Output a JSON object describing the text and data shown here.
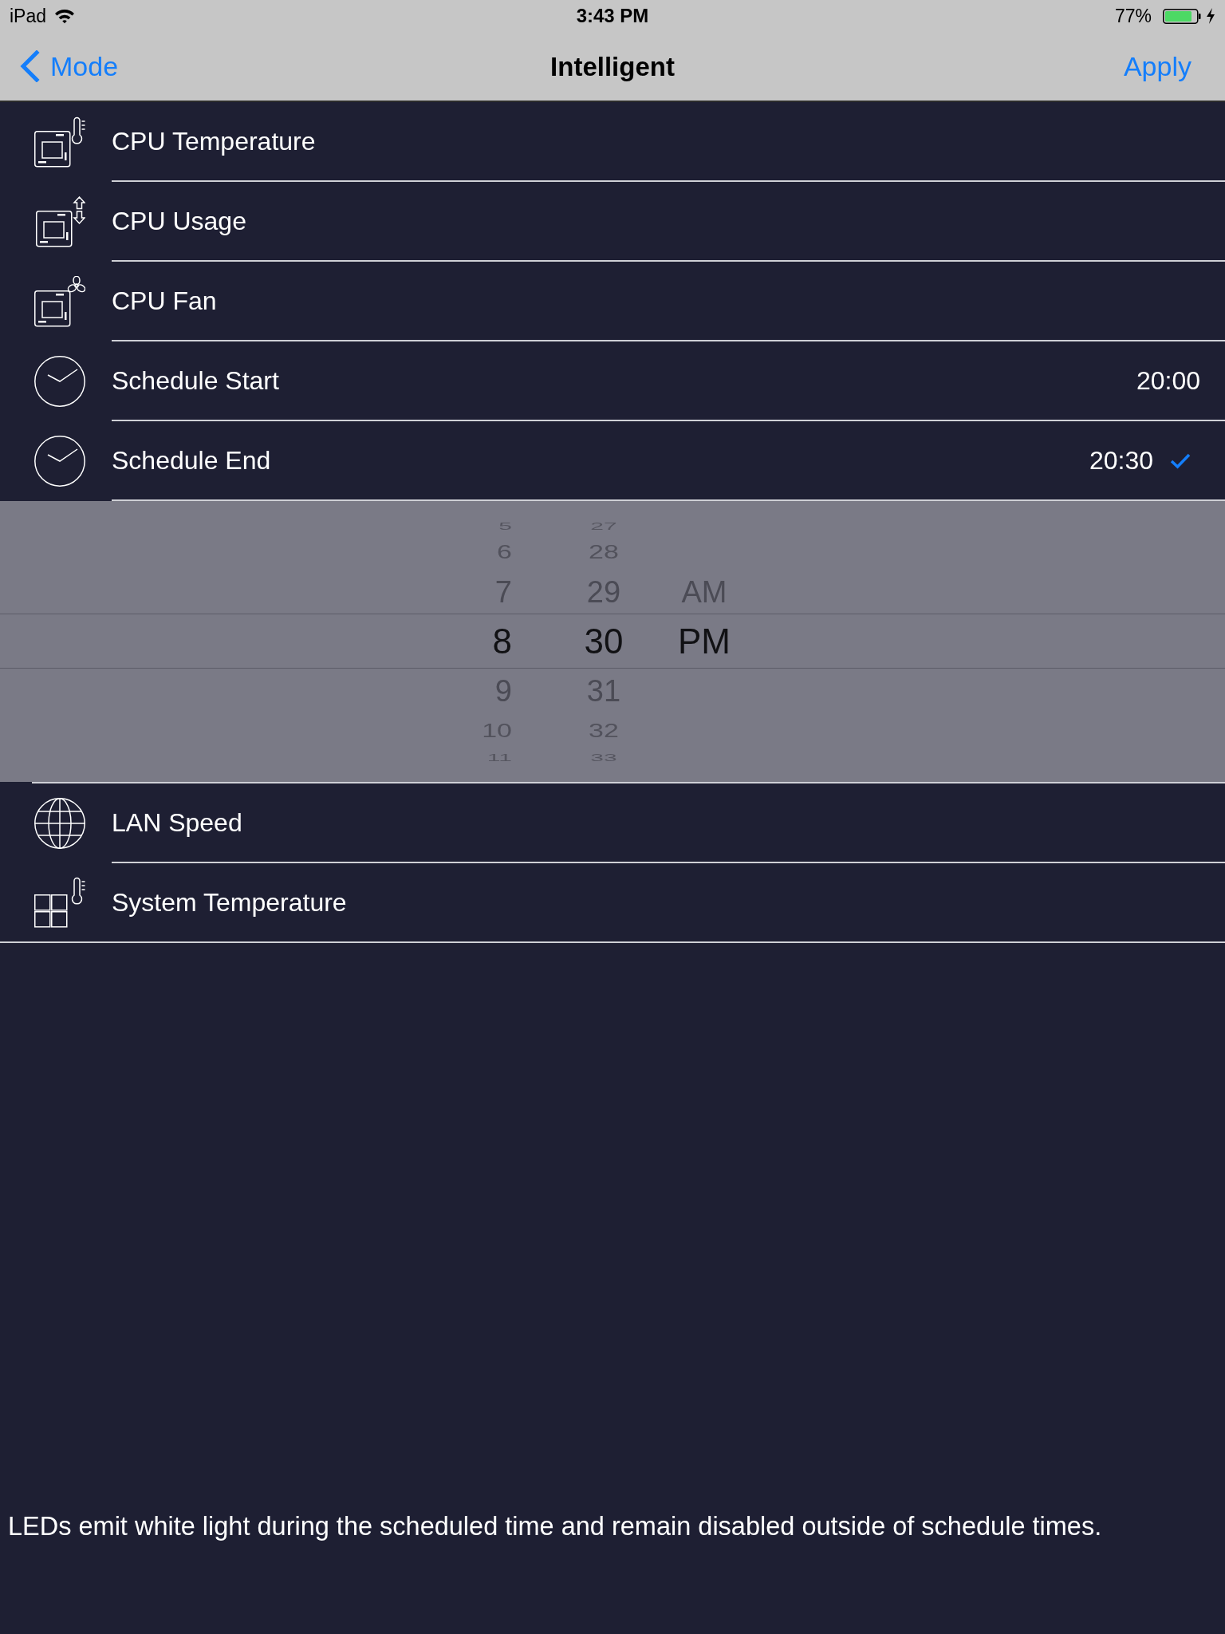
{
  "status_bar": {
    "device": "iPad",
    "time": "3:43 PM",
    "battery": "77%"
  },
  "nav_bar": {
    "back": "Mode",
    "title": "Intelligent",
    "action": "Apply"
  },
  "rows": [
    {
      "kind": "cpu_temperature",
      "label": "CPU Temperature",
      "selected": false
    },
    {
      "kind": "cpu_usage",
      "label": "CPU Usage",
      "selected": false
    },
    {
      "kind": "cpu_fan",
      "label": "CPU Fan",
      "selected": false
    },
    {
      "kind": "schedule",
      "label": "Schedule Start",
      "value": "20:00",
      "selected": false
    },
    {
      "kind": "schedule",
      "label": "Schedule End",
      "value": "20:30",
      "selected": true
    },
    {
      "kind": "lan_speed",
      "label": "LAN Speed",
      "selected": false
    },
    {
      "kind": "system_temperature",
      "label": "System Temperature",
      "selected": false
    }
  ],
  "time_picker": {
    "columns": [
      {
        "items": [
          {
            "text": "5",
            "selected": false
          },
          {
            "text": "6",
            "selected": false
          },
          {
            "text": "7",
            "selected": false
          },
          {
            "text": "8",
            "selected": true
          },
          {
            "text": "9",
            "selected": false
          },
          {
            "text": "10",
            "selected": false
          },
          {
            "text": "11",
            "selected": false
          }
        ]
      },
      {
        "items": [
          {
            "text": "27",
            "selected": false
          },
          {
            "text": "28",
            "selected": false
          },
          {
            "text": "29",
            "selected": false
          },
          {
            "text": "30",
            "selected": true
          },
          {
            "text": "31",
            "selected": false
          },
          {
            "text": "32",
            "selected": false
          },
          {
            "text": "33",
            "selected": false
          }
        ]
      },
      {
        "items": [
          {
            "text": "AM",
            "selected": false
          },
          {
            "text": "PM",
            "selected": true
          }
        ]
      }
    ]
  },
  "footer": "LEDs emit white light during the scheduled time and remain disabled outside of schedule times."
}
